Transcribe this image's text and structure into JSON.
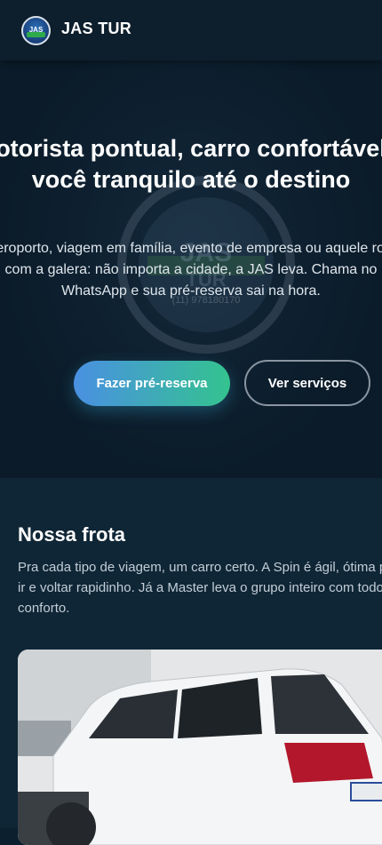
{
  "header": {
    "brand": "JAS TUR",
    "logo_text": "JAS"
  },
  "hero": {
    "title": "Motorista pontual, carro confortável e você tranquilo até o destino",
    "text": "Aeroporto, viagem em família, evento de empresa ou aquele rolê com a galera: não importa a cidade, a JAS leva. Chama no WhatsApp e sua pré-reserva sai na hora.",
    "primary_button": "Fazer pré-reserva",
    "secondary_button": "Ver serviços",
    "watermark": {
      "title": "JAS",
      "subtitle": "TUR",
      "phone": "(11) 978180170"
    }
  },
  "fleet": {
    "title": "Nossa frota",
    "text": "Pra cada tipo de viagem, um carro certo. A Spin é ágil, ótima pra ir e voltar rapidinho. Já a Master leva o grupo inteiro com todo conforto."
  },
  "colors": {
    "background": "#0b1f2f",
    "accent_start": "#4a90e2",
    "accent_end": "#34c38f"
  }
}
